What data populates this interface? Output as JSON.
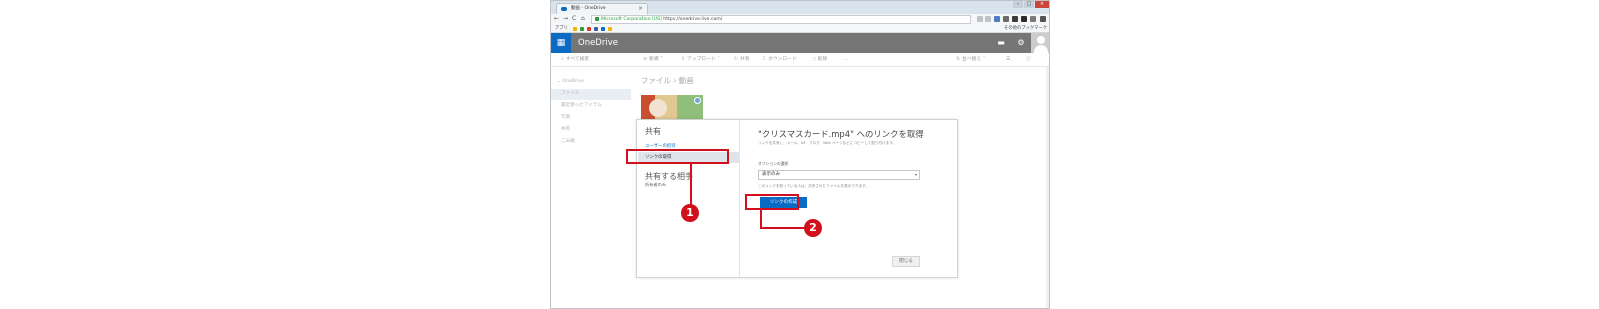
{
  "browser": {
    "tab_title": "動画 - OneDrive",
    "tab_close": "×",
    "window_controls": [
      "–",
      "□",
      "×"
    ],
    "nav_buttons": [
      "←",
      "→",
      "C",
      "⌂"
    ],
    "url_secure_label": "Microsoft Corporation [US]",
    "url": "https://onedrive.live.com/",
    "bookmarks_apps": "アプリ",
    "bookmarks_other": "その他のブックマーク",
    "extension_colors": [
      "#f2b300",
      "#2a9d3a",
      "#d23c2b",
      "#3b5998",
      "#0a6bc5"
    ]
  },
  "header": {
    "waffle_icon": "▦",
    "brand": "OneDrive",
    "chat_icon": "▬",
    "settings_icon": "⚙",
    "brand_color": "#0a6bc5"
  },
  "commandbar": {
    "search": "すべて検索",
    "new": "新規",
    "upload": "アップロード",
    "share": "共有",
    "download": "ダウンロード",
    "delete": "削除",
    "more": "…",
    "sort": "並べ替え"
  },
  "leftnav": {
    "root": "OneDrive",
    "items": [
      "ファイル",
      "最近使ったアイテム",
      "写真",
      "共有",
      "ごみ箱"
    ]
  },
  "breadcrumb": [
    "ファイル",
    "動画"
  ],
  "dialog": {
    "share_title": "共有",
    "invite_people": "ユーザーの招待",
    "get_link": "リンクの取得",
    "shared_with": "共有する相手",
    "owner": "所有者のみ",
    "right_title": "\"クリスマスカード.mp4\" へのリンクを取得",
    "description": "リンクを共有し、メール、IM、ブログ、Web ページなどにコピーして貼り付けます。",
    "option_label": "オプションの選択",
    "select_value": "表示のみ",
    "note": "このリンクを知っている人は、共有されたファイルを表示できます。",
    "create_link": "リンクの作成",
    "close": "閉じる"
  },
  "annotations": {
    "badge1": "1",
    "badge2": "2",
    "color": "#d10f1d"
  }
}
